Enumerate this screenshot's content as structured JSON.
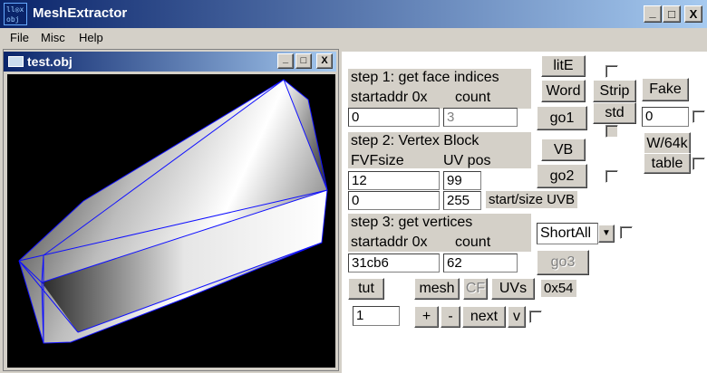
{
  "window": {
    "title": "MeshExtractor",
    "icon_text": [
      "ll◎x",
      "obj"
    ],
    "icon": "app-icon"
  },
  "caption_buttons": {
    "minimize": "_",
    "maximize": "□",
    "close": "X"
  },
  "menu": [
    "File",
    "Misc",
    "Help"
  ],
  "child_window": {
    "title": "test.obj",
    "icon": "document-icon"
  },
  "step1": {
    "title": "step 1: get face indices",
    "addr_label": "startaddr 0x",
    "count_label": "count",
    "addr_value": "0",
    "count_value": "3"
  },
  "step2": {
    "title": "step 2: Vertex Block",
    "fvf_label": "FVFsize",
    "uv_label": "UV pos",
    "fvf_value": "12",
    "uv_value": "99",
    "start_value": "0",
    "size_value": "255",
    "uvb_label": "start/size UVB"
  },
  "step3": {
    "title": "step 3: get vertices",
    "addr_label": "startaddr 0x",
    "count_label": "count",
    "addr_value": "31cb6",
    "count_value": "62"
  },
  "buttons": {
    "litE": "litE",
    "word": "Word",
    "strip": "Strip",
    "fake": "Fake",
    "go1": "go1",
    "std": "std",
    "vb": "VB",
    "w64k": "W/64k",
    "table": "table",
    "go2": "go2",
    "go3": "go3",
    "tut": "tut",
    "mesh": "mesh",
    "cf": "CF",
    "uvs": "UVs",
    "plus": "+",
    "minus": "-",
    "next": "next",
    "v": "v"
  },
  "fake_field_value": "0",
  "dropdown": {
    "selected": "ShortAll"
  },
  "hex_label": "0x54",
  "index_field_value": "1",
  "colors": {
    "titlebar_start": "#0a246a",
    "titlebar_end": "#a6caf0",
    "wire": "#1010ff"
  }
}
